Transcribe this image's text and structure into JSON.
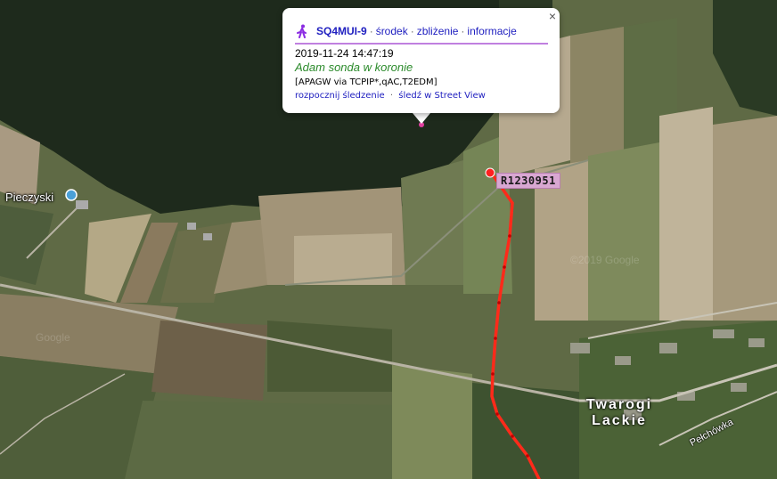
{
  "popup": {
    "callsign": "SQ4MUI-9",
    "links": [
      "środek",
      "zbliżenie",
      "informacje"
    ],
    "close_glyph": "×",
    "timestamp": "2019-11-24 14:47:19",
    "comment": "Adam sonda w koronie",
    "path": "[APAGW via TCPIP*,qAC,T2EDM]",
    "track_links": [
      "rozpocznij śledzenie",
      "śledź w Street View"
    ],
    "icon": "walking-person-icon"
  },
  "map": {
    "object_label": "R1230951",
    "places": {
      "pieczyski": "Pieczyski",
      "twarogi_line1": "Twarogi",
      "twarogi_line2": "Lackie",
      "road": "Pełchówka"
    },
    "watermarks": [
      "©2019 Google",
      "Google"
    ],
    "colors": {
      "track": "#ff2a1a",
      "label_bg": "#d9a7d2",
      "link": "#2020c0",
      "comment": "#2a8a2a",
      "divider": "#c080e0"
    }
  }
}
